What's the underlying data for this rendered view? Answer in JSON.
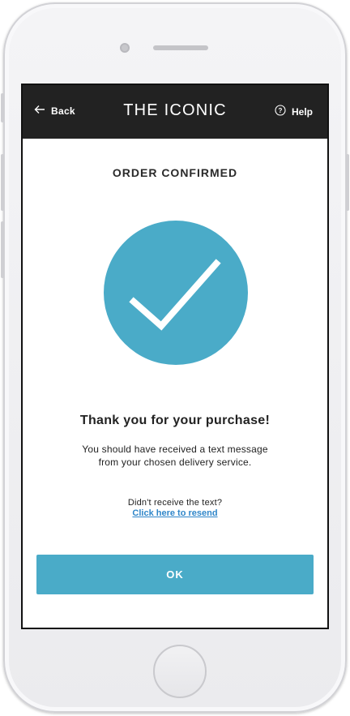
{
  "header": {
    "back_label": "Back",
    "brand": "THE ICONIC",
    "help_label": "Help"
  },
  "main": {
    "title": "ORDER CONFIRMED",
    "thanks": "Thank you for your purchase!",
    "message_line1": "You should have received a text message",
    "message_line2": "from your chosen delivery service.",
    "resend_question": "Didn't receive the text?",
    "resend_link": "Click here to resend",
    "ok_label": "OK"
  },
  "icons": {
    "back": "arrow-left-icon",
    "help": "question-circle-icon",
    "confirmation": "checkmark-icon"
  },
  "colors": {
    "accent": "#4aabc8",
    "navbar": "#222222",
    "link": "#2f86c9"
  }
}
